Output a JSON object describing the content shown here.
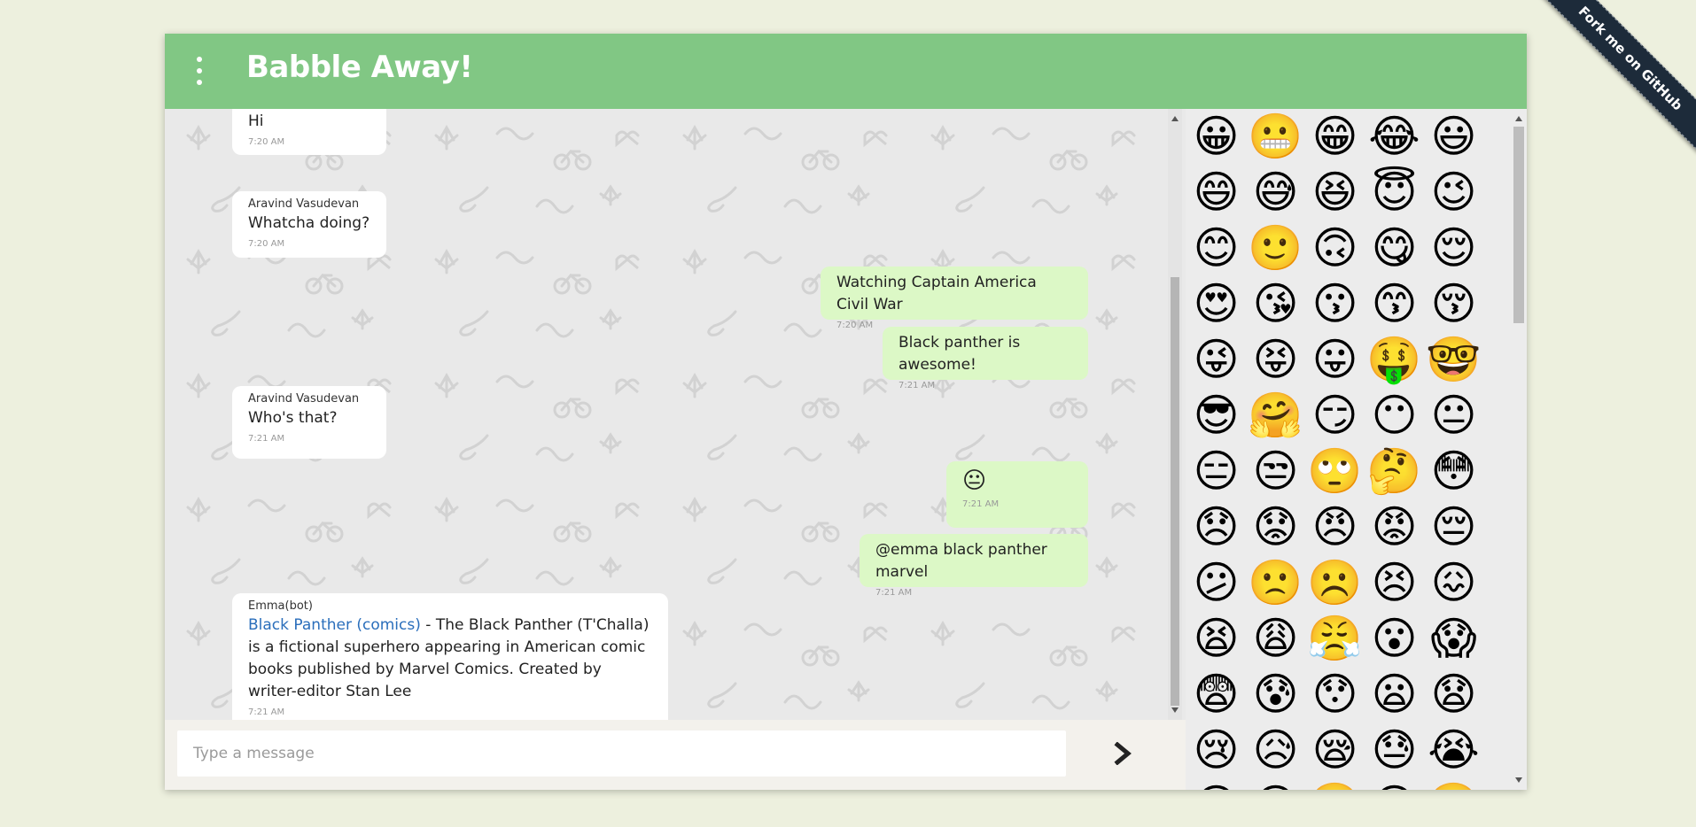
{
  "ribbon": {
    "label": "Fork me on GitHub"
  },
  "header": {
    "title": "Babble Away!"
  },
  "messages": [
    {
      "sender": "",
      "text": "Hi",
      "time": "7:20 AM",
      "mine": false
    },
    {
      "sender": "Aravind Vasudevan",
      "text": "Whatcha doing?",
      "time": "7:20 AM",
      "mine": false
    },
    {
      "sender": "",
      "text": "Watching Captain America Civil War",
      "time": "7:20 AM",
      "mine": true
    },
    {
      "sender": "",
      "text": "Black panther is awesome!",
      "time": "7:21 AM",
      "mine": true
    },
    {
      "sender": "Aravind Vasudevan",
      "text": "Who's that?",
      "time": "7:21 AM",
      "mine": false
    },
    {
      "sender": "",
      "text": "😐",
      "time": "7:21 AM",
      "mine": true
    },
    {
      "sender": "",
      "text": "@emma black panther marvel",
      "time": "7:21 AM",
      "mine": true
    },
    {
      "sender": "Emma(bot)",
      "link": "Black Panther (comics)",
      "text": " - The Black Panther (T'Challa) is a fictional superhero appearing in American comic books published by Marvel Comics. Created by writer-editor Stan Lee",
      "time": "7:21 AM",
      "mine": false
    }
  ],
  "input": {
    "placeholder": "Type a message"
  },
  "emojis": [
    "😀",
    "😬",
    "😁",
    "😂",
    "😃",
    "😄",
    "😅",
    "😆",
    "😇",
    "😉",
    "😊",
    "🙂",
    "🙃",
    "😋",
    "😌",
    "😍",
    "😘",
    "😗",
    "😙",
    "😚",
    "😜",
    "😝",
    "😛",
    "🤑",
    "🤓",
    "😎",
    "🤗",
    "😏",
    "😶",
    "😐",
    "😑",
    "😒",
    "🙄",
    "🤔",
    "😳",
    "😞",
    "😟",
    "😠",
    "😡",
    "😔",
    "😕",
    "🙁",
    "☹️",
    "😣",
    "😖",
    "😫",
    "😩",
    "😤",
    "😮",
    "😱",
    "😨",
    "😰",
    "😯",
    "😦",
    "😧",
    "😢",
    "😥",
    "😪",
    "😓",
    "😭",
    "😵",
    "😲",
    "🤐",
    "😷",
    "🤒"
  ],
  "colors": {
    "header": "#81c784",
    "mine_bubble": "#dcf8c6",
    "other_bubble": "#ffffff",
    "link": "#2a6ebb"
  }
}
